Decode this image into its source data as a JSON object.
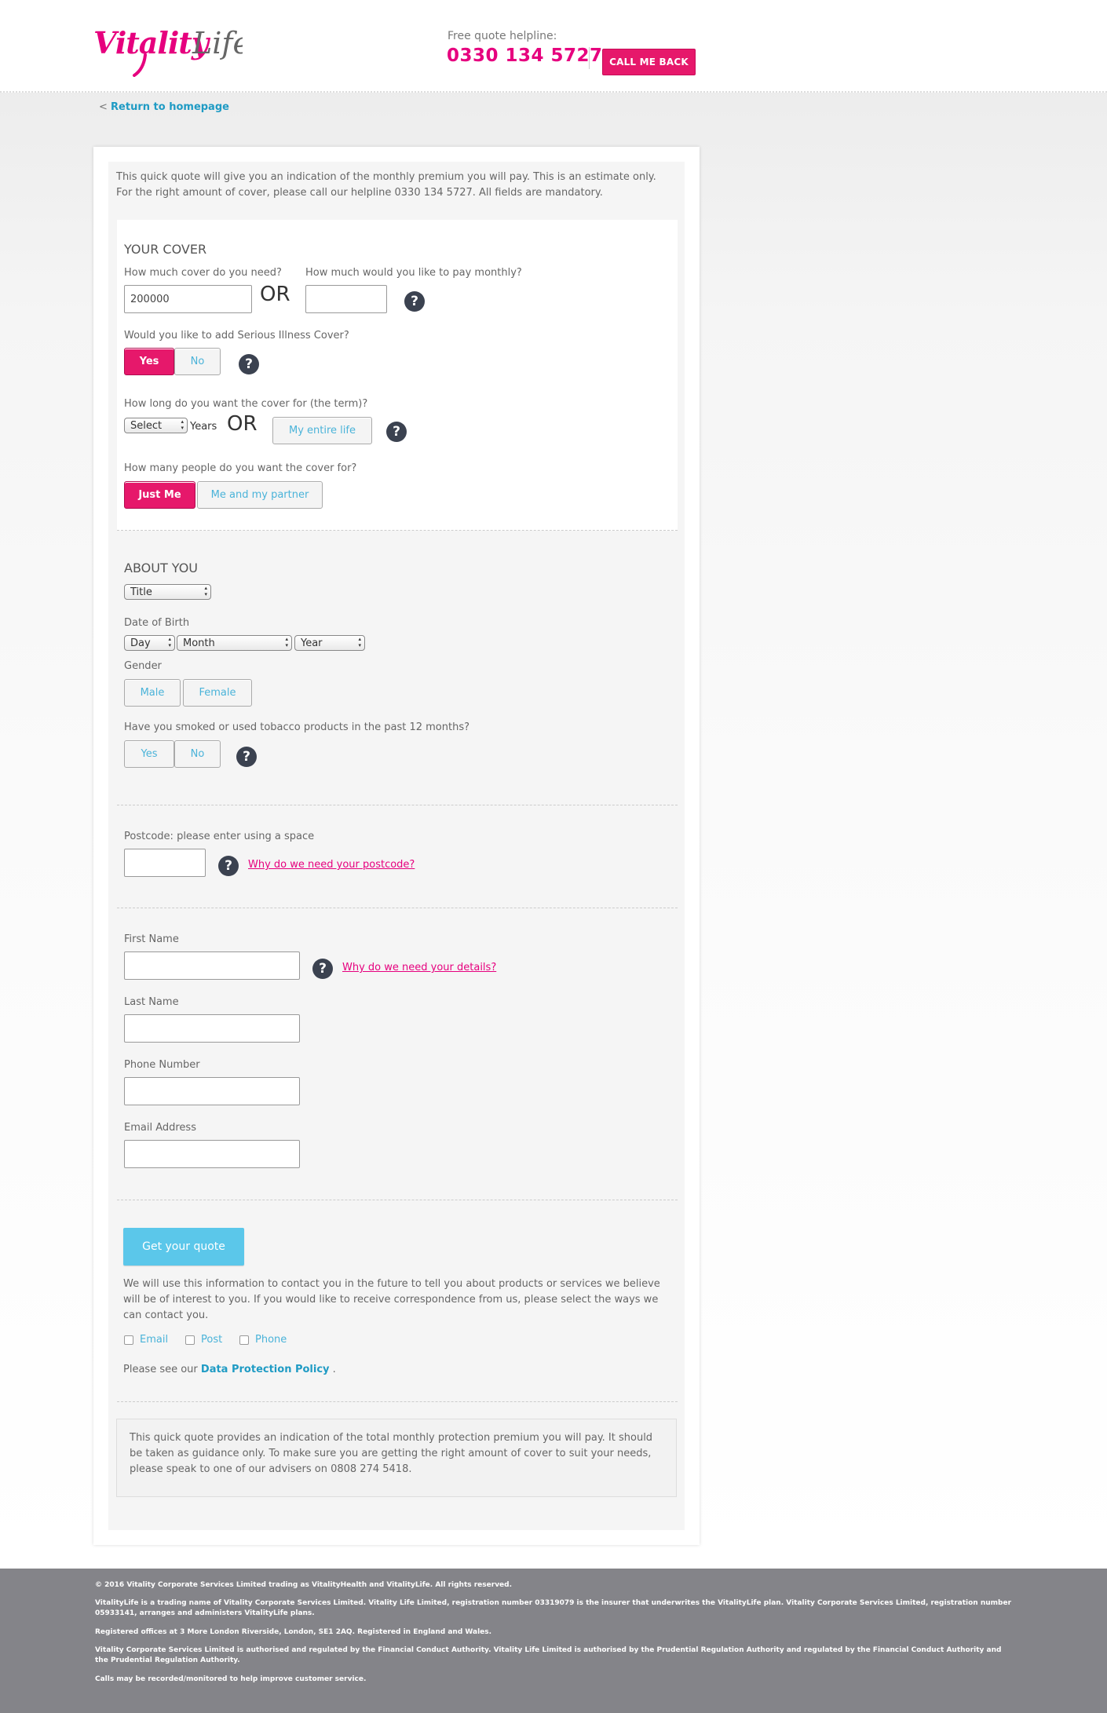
{
  "header": {
    "logo_text_1": "Vitality",
    "logo_text_2": "Life",
    "helpline_label": "Free quote helpline:",
    "helpline_number": "0330 134 5727",
    "call_back_label": "CALL ME BACK",
    "return_prefix": "<",
    "return_label": "Return to homepage"
  },
  "intro": "This quick quote will give you an indication of the monthly premium you will pay. This is an estimate only. For the right amount of cover, please call our helpline 0330 134 5727. All fields are mandatory.",
  "cover": {
    "title": "YOUR COVER",
    "amount_label": "How much cover do you need?",
    "amount_value": "200000",
    "or_text": "OR",
    "monthly_label": "How much would you like to pay monthly?",
    "monthly_value": "",
    "serious_label": "Would you like to add Serious Illness Cover?",
    "serious_yes": "Yes",
    "serious_no": "No",
    "term_label": "How long do you want the cover for (the term)?",
    "term_select": "Select",
    "term_years": "Years",
    "entire_life": "My entire life",
    "people_label": "How many people do you want the cover for?",
    "just_me": "Just Me",
    "me_partner": "Me and my partner"
  },
  "about": {
    "title": "ABOUT YOU",
    "title_select": "Title",
    "dob_label": "Date of Birth",
    "dob_day": "Day",
    "dob_month": "Month",
    "dob_year": "Year",
    "gender_label": "Gender",
    "male": "Male",
    "female": "Female",
    "smoke_label": "Have you smoked or used tobacco products in the past 12 months?",
    "smoke_yes": "Yes",
    "smoke_no": "No"
  },
  "postcode": {
    "label": "Postcode: please enter using a space",
    "value": "",
    "why_link": "Why do we need your postcode?"
  },
  "details": {
    "first_name_label": "First Name",
    "why_link": "Why do we need your details?",
    "last_name_label": "Last Name",
    "phone_label": "Phone Number",
    "email_label": "Email Address"
  },
  "submit": {
    "quote_button": "Get your quote",
    "consent_text": "We will use this information to contact you in the future to tell you about products or services we believe will be of interest to you. If you would like to receive correspondence from us, please select the ways we can contact you.",
    "opt_email": "Email",
    "opt_post": "Post",
    "opt_phone": "Phone",
    "dpp_prefix": "Please see our",
    "dpp_link": "Data Protection Policy",
    "dpp_suffix": "."
  },
  "disclaimer": "This quick quote provides an indication of the total monthly protection premium you will pay. It should be taken as guidance only. To make sure you are getting the right amount of cover to suit your needs, please speak to one of our advisers on 0808 274 5418.",
  "footer": {
    "copyright": "© 2016 Vitality Corporate Services Limited trading as VitalityHealth and VitalityLife. All rights reserved.",
    "trading": "VitalityLife is a trading name of Vitality Corporate Services Limited. Vitality Life Limited, registration number 03319079 is the insurer that underwrites the VitalityLife plan. Vitality Corporate Services Limited, registration number 05933141, arranges and administers VitalityLife plans.",
    "registered": "Registered offices at 3 More London Riverside, London, SE1 2AQ. Registered in England and Wales.",
    "regulation": "Vitality Corporate Services Limited is authorised and regulated by the Financial Conduct Authority. Vitality Life Limited is authorised by the Prudential Regulation Authority and regulated by the Financial Conduct Authority and the Prudential Regulation Authority.",
    "calls": "Calls may be recorded/monitored to help improve customer service."
  },
  "colors": {
    "brand_pink": "#e6186b",
    "link_blue": "#1f9bc4",
    "quote_button_blue": "#5bc7ea",
    "help_icon_dark": "#3b4250",
    "footer_grey": "#848489"
  }
}
